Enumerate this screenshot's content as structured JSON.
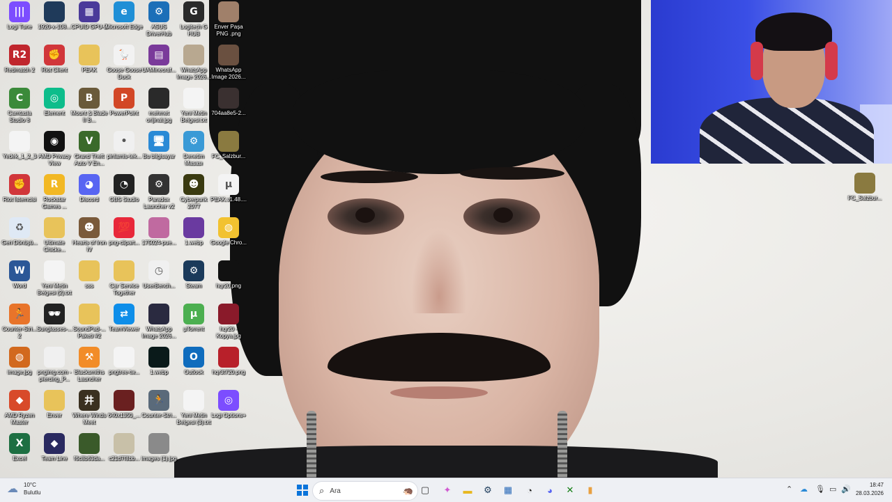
{
  "desktop": {
    "icons": [
      {
        "label": "Logi Tune",
        "icon": "logi-tune-icon",
        "color": "#7c4dff",
        "glyph": "|||"
      },
      {
        "label": "1920-x-108...",
        "icon": "image-file-icon",
        "color": "#1f3a5a",
        "glyph": ""
      },
      {
        "label": "CPUID GPU-Z",
        "icon": "gpu-z-icon",
        "color": "#4a3a9a",
        "glyph": "▦"
      },
      {
        "label": "Microsoft Edge",
        "icon": "edge-icon",
        "color": "#1f8fd6",
        "glyph": "e"
      },
      {
        "label": "ASUS DriverHub",
        "icon": "asus-driverhub-icon",
        "color": "#1c6fb8",
        "glyph": "⚙"
      },
      {
        "label": "Logitech G HUB",
        "icon": "logitech-ghub-icon",
        "color": "#2a2a2a",
        "glyph": "G"
      },
      {
        "label": "Enver Paşa PNG .png",
        "icon": "png-file-icon",
        "color": "#a0806a",
        "glyph": ""
      },
      {
        "label": "Redmatch 2",
        "icon": "redmatch-icon",
        "color": "#c0262d",
        "glyph": "R2"
      },
      {
        "label": "Riot Client",
        "icon": "riot-client-icon",
        "color": "#d1363a",
        "glyph": "✊"
      },
      {
        "label": "PEAK",
        "icon": "folder-icon",
        "color": "#e8c35a",
        "glyph": ""
      },
      {
        "label": "Goose Goose Duck",
        "icon": "goose-duck-icon",
        "color": "#f2f2f2",
        "glyph": "🪿"
      },
      {
        "label": "UAMinecraf...",
        "icon": "winrar-icon",
        "color": "#7a3a9a",
        "glyph": "▤"
      },
      {
        "label": "WhatsApp Image 2026...",
        "icon": "image-file-icon",
        "color": "#b8a890",
        "glyph": ""
      },
      {
        "label": "WhatsApp Image 2026...",
        "icon": "image-file-icon",
        "color": "#6a5040",
        "glyph": ""
      },
      {
        "label": "Camtasia Studio 8",
        "icon": "camtasia-icon",
        "color": "#3b8a3a",
        "glyph": "C"
      },
      {
        "label": "Element",
        "icon": "element-icon",
        "color": "#0dbd8b",
        "glyph": "◎"
      },
      {
        "label": "Mount & Blade II B...",
        "icon": "bannerlord-icon",
        "color": "#6a5a3a",
        "glyph": "B"
      },
      {
        "label": "PowerPoint",
        "icon": "powerpoint-icon",
        "color": "#d24726",
        "glyph": "P"
      },
      {
        "label": "mehmet orijinal.jpg",
        "icon": "image-file-icon",
        "color": "#2a2a2a",
        "glyph": ""
      },
      {
        "label": "Yeni Metin Belgesi.txt",
        "icon": "text-file-icon",
        "color": "#f4f4f4",
        "glyph": ""
      },
      {
        "label": "704aa8e5-2...",
        "icon": "image-file-icon",
        "color": "#3a3030",
        "glyph": ""
      },
      {
        "label": "Yedek_1_2_3",
        "icon": "document-file-icon",
        "color": "#f4f4f4",
        "glyph": ""
      },
      {
        "label": "AMD Privacy View",
        "icon": "amd-privacy-icon",
        "color": "#111111",
        "glyph": "◉"
      },
      {
        "label": "Grand Theft Auto V En...",
        "icon": "gta-v-icon",
        "color": "#3a6a2a",
        "glyph": "V"
      },
      {
        "label": "pinlamis-tek...",
        "icon": "image-file-icon",
        "color": "#f0f0f0",
        "glyph": "•"
      },
      {
        "label": "Bu bilgisayar",
        "icon": "this-pc-icon",
        "color": "#2a8ad6",
        "glyph": "🖥"
      },
      {
        "label": "Denetim Masası",
        "icon": "control-panel-icon",
        "color": "#3a9ad6",
        "glyph": "⚙"
      },
      {
        "label": "FC_Salzbur...",
        "icon": "image-file-icon",
        "color": "#8a7a40",
        "glyph": ""
      },
      {
        "label": "Riot İstemcisi",
        "icon": "riot-client-icon",
        "color": "#d1363a",
        "glyph": "✊"
      },
      {
        "label": "Rockstar Games ...",
        "icon": "rockstar-icon",
        "color": "#f2b824",
        "glyph": "R"
      },
      {
        "label": "Discord",
        "icon": "discord-icon",
        "color": "#5865f2",
        "glyph": "◕"
      },
      {
        "label": "OBS Studio",
        "icon": "obs-icon",
        "color": "#222222",
        "glyph": "◔"
      },
      {
        "label": "Paradox Launcher v2",
        "icon": "paradox-icon",
        "color": "#333333",
        "glyph": "⚙"
      },
      {
        "label": "Cyberpunk 2077",
        "icon": "cyberpunk-icon",
        "color": "#3a3a10",
        "glyph": "☻"
      },
      {
        "label": "PEAK.v1.48....",
        "icon": "torrent-file-icon",
        "color": "#f4f4f4",
        "glyph": "µ"
      },
      {
        "label": "Geri Dönüşü...",
        "icon": "recycle-bin-icon",
        "color": "#dfe9f5",
        "glyph": "♻"
      },
      {
        "label": "Ultimate Chicke...",
        "icon": "folder-icon",
        "color": "#e8c35a",
        "glyph": ""
      },
      {
        "label": "Hearts of Iron IV",
        "icon": "hoi4-icon",
        "color": "#7a5a3a",
        "glyph": "☻"
      },
      {
        "label": "png-clipart...",
        "icon": "png-file-icon",
        "color": "#e8283a",
        "glyph": "💯"
      },
      {
        "label": "175024-pue...",
        "icon": "image-file-icon",
        "color": "#c06aa0",
        "glyph": ""
      },
      {
        "label": "1.webp",
        "icon": "image-file-icon",
        "color": "#6a3aa0",
        "glyph": ""
      },
      {
        "label": "Google Chro...",
        "icon": "chrome-icon",
        "color": "#f2c230",
        "glyph": "◍"
      },
      {
        "label": "Word",
        "icon": "word-icon",
        "color": "#2b5797",
        "glyph": "W"
      },
      {
        "label": "Yeni Metin Belgesi (2).txt",
        "icon": "text-file-icon",
        "color": "#f4f4f4",
        "glyph": ""
      },
      {
        "label": "sss",
        "icon": "folder-icon",
        "color": "#e8c35a",
        "glyph": ""
      },
      {
        "label": "Car Service Together",
        "icon": "folder-icon",
        "color": "#e8c35a",
        "glyph": ""
      },
      {
        "label": "UserBench...",
        "icon": "userbenchmark-icon",
        "color": "#f0f0f0",
        "glyph": "◷"
      },
      {
        "label": "Steam",
        "icon": "steam-icon",
        "color": "#1b3a5a",
        "glyph": "⚙"
      },
      {
        "label": "hqr20.png",
        "icon": "image-file-icon",
        "color": "#111111",
        "glyph": ""
      },
      {
        "label": "Counter-Stri... 2",
        "icon": "cs2-icon",
        "color": "#e8742a",
        "glyph": "🏃"
      },
      {
        "label": "Sunglasses-...",
        "icon": "image-file-icon",
        "color": "#222222",
        "glyph": "🕶"
      },
      {
        "label": "SoundPad-... Paketi #2",
        "icon": "folder-icon",
        "color": "#e8c35a",
        "glyph": ""
      },
      {
        "label": "TeamViewer",
        "icon": "teamviewer-icon",
        "color": "#0e8ee9",
        "glyph": "⇄"
      },
      {
        "label": "WhatsApp Image 2026...",
        "icon": "image-file-icon",
        "color": "#2a2a40",
        "glyph": ""
      },
      {
        "label": "µTorrent",
        "icon": "utorrent-icon",
        "color": "#4caf50",
        "glyph": "µ"
      },
      {
        "label": "hqr20 - Kopya.jpg",
        "icon": "image-file-icon",
        "color": "#8a1a2a",
        "glyph": ""
      },
      {
        "label": "image.jpg",
        "icon": "image-file-icon",
        "color": "#d2691e",
        "glyph": "◍"
      },
      {
        "label": "pngimg.com - piercing_P...",
        "icon": "png-file-icon",
        "color": "#f0f0f0",
        "glyph": ""
      },
      {
        "label": "Blacksmiths Launcher",
        "icon": "blacksmiths-icon",
        "color": "#f28c28",
        "glyph": "⚒"
      },
      {
        "label": "pngtree-tw...",
        "icon": "png-file-icon",
        "color": "#f4f4f4",
        "glyph": ""
      },
      {
        "label": "1.webp",
        "icon": "image-file-icon",
        "color": "#0a1a1a",
        "glyph": ""
      },
      {
        "label": "Outlook",
        "icon": "outlook-icon",
        "color": "#0f6cbd",
        "glyph": "O"
      },
      {
        "label": "hqr3t720.png",
        "icon": "image-file-icon",
        "color": "#b8202a",
        "glyph": ""
      },
      {
        "label": "AMD Ryzen Master",
        "icon": "amd-ryzen-icon",
        "color": "#d84a2a",
        "glyph": "◆"
      },
      {
        "label": "Enver",
        "icon": "folder-icon",
        "color": "#e8c35a",
        "glyph": ""
      },
      {
        "label": "Where Winds Meet",
        "icon": "where-winds-meet-icon",
        "color": "#3a3020",
        "glyph": "井"
      },
      {
        "label": "640x1350_...",
        "icon": "image-file-icon",
        "color": "#6a2020",
        "glyph": ""
      },
      {
        "label": "Counter-Stri...",
        "icon": "cs-icon",
        "color": "#5a6a7a",
        "glyph": "🏃"
      },
      {
        "label": "Yeni Metin Belgesi (3).txt",
        "icon": "text-file-icon",
        "color": "#f4f4f4",
        "glyph": ""
      },
      {
        "label": "Logi Options+",
        "icon": "logi-options-icon",
        "color": "#7c4dff",
        "glyph": "◎"
      },
      {
        "label": "Excel",
        "icon": "excel-icon",
        "color": "#1d6f42",
        "glyph": "X"
      },
      {
        "label": "Team Line",
        "icon": "teamline-icon",
        "color": "#2a2a60",
        "glyph": "◆"
      },
      {
        "label": "f6c8b63da...",
        "icon": "image-file-icon",
        "color": "#3a5a2a",
        "glyph": ""
      },
      {
        "label": "c21d7f8bb...",
        "icon": "image-file-icon",
        "color": "#c8c0a8",
        "glyph": ""
      },
      {
        "label": "images (1).jpg",
        "icon": "image-file-icon",
        "color": "#8a8a8a",
        "glyph": ""
      },
      {
        "label": "FC_Salzbur...",
        "icon": "image-file-icon",
        "color": "#8a7a40",
        "glyph": ""
      }
    ]
  },
  "taskbar": {
    "weather_temp": "10°C",
    "weather_desc": "Bulutlu",
    "search_placeholder": "Ara",
    "time": "18:47",
    "date": "28.03.2026",
    "pinned": [
      {
        "name": "start-button",
        "glyph": "⊞",
        "color": "#0a74da"
      },
      {
        "name": "task-view-icon",
        "glyph": "▢",
        "color": "#333"
      },
      {
        "name": "copilot-icon",
        "glyph": "✦",
        "color": "#d05ad0"
      },
      {
        "name": "file-explorer-icon",
        "glyph": "▬",
        "color": "#e8b820"
      },
      {
        "name": "steam-icon",
        "glyph": "⚙",
        "color": "#1b3a5a"
      },
      {
        "name": "calendar-app-icon",
        "glyph": "▦",
        "color": "#2a6ab8"
      },
      {
        "name": "obs-taskbar-icon",
        "glyph": "◔",
        "color": "#222"
      },
      {
        "name": "discord-taskbar-icon",
        "glyph": "◕",
        "color": "#5865f2"
      },
      {
        "name": "xbox-icon",
        "glyph": "✕",
        "color": "#107c10"
      },
      {
        "name": "app-window-icon",
        "glyph": "▮",
        "color": "#e8a040"
      }
    ]
  }
}
